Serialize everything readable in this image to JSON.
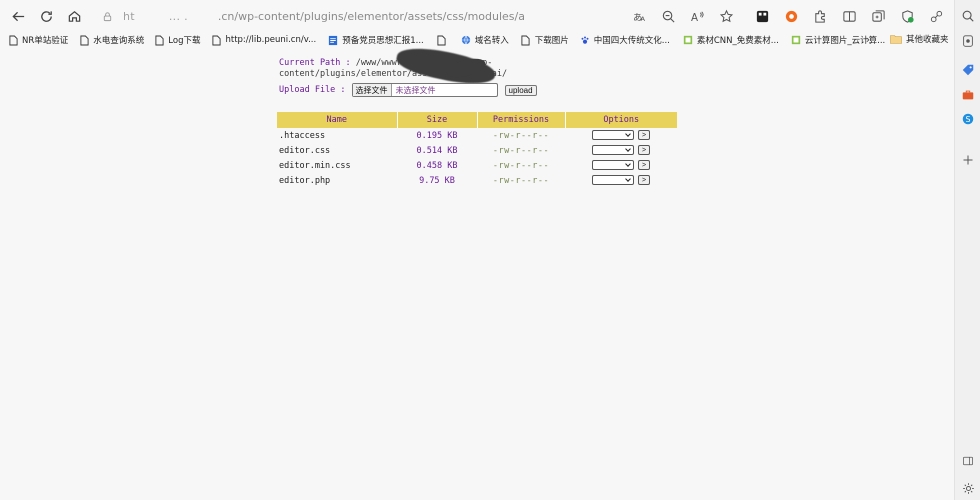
{
  "browser": {
    "url_prefix": "ht",
    "url_dots": "... .",
    "url_path": ".cn/wp-content/plugins/elementor/assets/css/modules/ai/editor.php"
  },
  "bookmarks": [
    {
      "label": "NR单站验证",
      "icon": "page-icon"
    },
    {
      "label": "水电查询系统",
      "icon": "page-icon"
    },
    {
      "label": "Log下载",
      "icon": "page-icon"
    },
    {
      "label": "http://lib.peuni.cn/v...",
      "icon": "page-icon"
    },
    {
      "label": "预备党员思想汇报1...",
      "icon": "document-icon"
    },
    {
      "label": "",
      "icon": "page-icon"
    },
    {
      "label": "域名转入",
      "icon": "globe-icon"
    },
    {
      "label": "下载图片",
      "icon": "page-icon"
    },
    {
      "label": "中国四大传统文化...",
      "icon": "paw-icon"
    },
    {
      "label": "素材CNN_免费素材...",
      "icon": "green-square-icon"
    },
    {
      "label": "云计算图片_云计算...",
      "icon": "green-square-icon"
    }
  ],
  "bookmarks_other": "其他收藏夹",
  "page": {
    "current_path_label": "Current Path :",
    "current_path_value_1": "/www/wwwro",
    "current_path_value_1b": "wp-",
    "current_path_value_2": "content/plugins/elementor/assets/css/mod",
    "current_path_value_2b": "ai/",
    "upload_label": "Upload File :",
    "choose_file": "选择文件",
    "no_file": "未选择文件",
    "upload_button": "upload"
  },
  "table": {
    "headers": [
      "Name",
      "Size",
      "Permissions",
      "Options"
    ],
    "rows": [
      {
        "name": ".htaccess",
        "size": "0.195 KB",
        "perm": "-rw-r--r--"
      },
      {
        "name": "editor.css",
        "size": "0.514 KB",
        "perm": "-rw-r--r--"
      },
      {
        "name": "editor.min.css",
        "size": "0.458 KB",
        "perm": "-rw-r--r--"
      },
      {
        "name": "editor.php",
        "size": "9.75 KB",
        "perm": "-rw-r--r--"
      }
    ],
    "go_label": ">"
  }
}
